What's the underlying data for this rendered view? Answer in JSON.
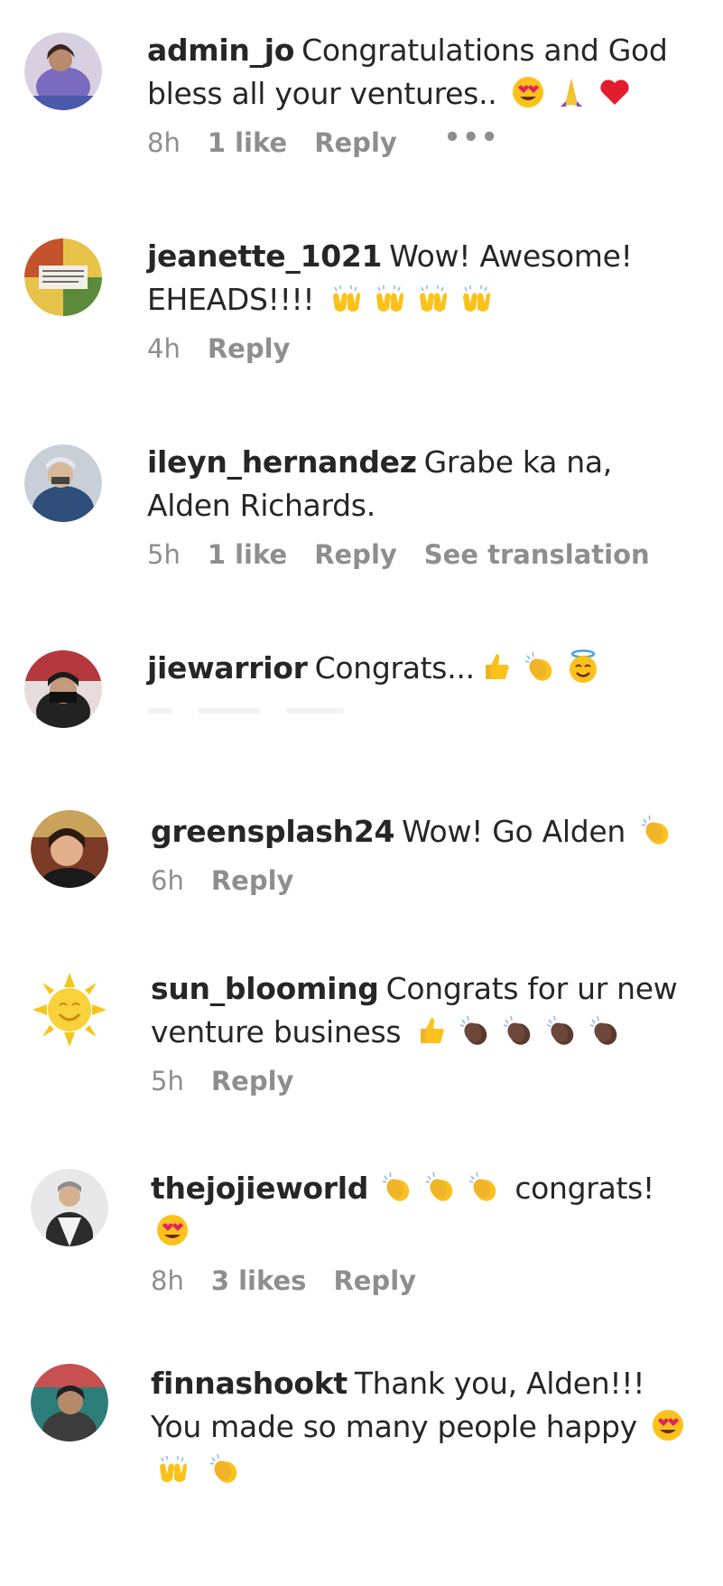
{
  "comments": [
    {
      "username": "admin_jo",
      "text": "Congratulations and God bless all your ventures..",
      "emojis": [
        "heart-eyes",
        "praying-hands",
        "red-heart"
      ],
      "time": "8h",
      "likes": "1 like",
      "reply": "Reply",
      "more": "•••",
      "avatar_color": "#7a6ac0"
    },
    {
      "username": "jeanette_1021",
      "text": "Wow! Awesome! EHEADS!!!!",
      "emojis": [
        "raising-hands",
        "raising-hands",
        "raising-hands",
        "raising-hands"
      ],
      "time": "4h",
      "reply": "Reply",
      "avatar_color": "#c4522a"
    },
    {
      "username": "ileyn_hernandez",
      "text": "Grabe ka na, Alden Richards.",
      "emojis": [],
      "time": "5h",
      "likes": "1 like",
      "reply": "Reply",
      "translation": "See translation",
      "avatar_color": "#2f4e7a"
    },
    {
      "username": "jiewarrior",
      "text": "Congrats...",
      "emojis": [
        "thumbs-up",
        "clapping-hands",
        "smiling-face-with-halo"
      ],
      "avatar_color": "#5a2430"
    },
    {
      "username": "greensplash24",
      "text": "Wow! Go Alden",
      "emojis": [
        "clapping-hands"
      ],
      "time": "6h",
      "reply": "Reply",
      "avatar_color": "#7b3b26"
    },
    {
      "username": "sun_blooming",
      "text": "Congrats for ur new venture business",
      "emojis": [
        "thumbs-up",
        "clapping-hands-dark",
        "clapping-hands-dark",
        "clapping-hands-dark",
        "clapping-hands-dark"
      ],
      "time": "5h",
      "reply": "Reply",
      "avatar_color": "#f5c518"
    },
    {
      "username": "thejojieworld",
      "text": "congrats!",
      "emojis_before_text": [
        "clapping-hands",
        "clapping-hands",
        "clapping-hands"
      ],
      "emojis": [
        "heart-eyes"
      ],
      "time": "8h",
      "likes": "3 likes",
      "reply": "Reply",
      "avatar_color": "#3a3a3a"
    },
    {
      "username": "finnashookt",
      "text": "Thank you, Alden!!! You made so many people happy",
      "emojis": [
        "heart-eyes",
        "raising-hands",
        "clapping-hands"
      ],
      "avatar_color": "#2e7d7a"
    }
  ]
}
